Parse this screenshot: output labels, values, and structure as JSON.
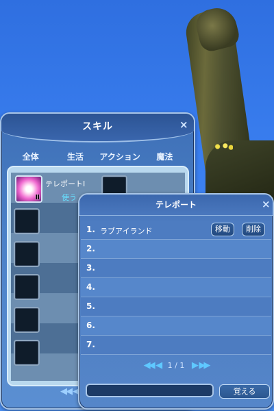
{
  "skill_window": {
    "title": "スキル",
    "close": "×",
    "tabs": [
      "全体",
      "生活",
      "アクション",
      "魔法"
    ],
    "skill": {
      "name": "テレポートⅠ",
      "level_badge": "Ⅱ",
      "use_label": "使う"
    },
    "pager": "◀◀ ◀"
  },
  "teleport_window": {
    "title": "テレポート",
    "close": "×",
    "rows": [
      {
        "num": "1.",
        "name": "ラブアイランド",
        "move_label": "移動",
        "delete_label": "削除"
      },
      {
        "num": "2.",
        "name": ""
      },
      {
        "num": "3.",
        "name": ""
      },
      {
        "num": "4.",
        "name": ""
      },
      {
        "num": "5.",
        "name": ""
      },
      {
        "num": "6.",
        "name": ""
      },
      {
        "num": "7.",
        "name": ""
      }
    ],
    "pager": {
      "first": "◀◀",
      "prev": "◀",
      "page": "1 / 1",
      "next": "▶",
      "last": "▶▶"
    },
    "input_value": "",
    "memorize_label": "覚える"
  }
}
